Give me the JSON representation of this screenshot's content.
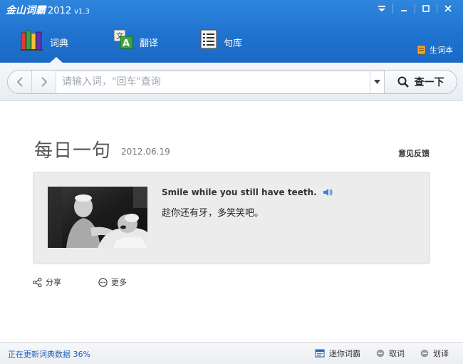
{
  "window": {
    "brand": "金山词霸",
    "year": "2012",
    "version": "v1.3"
  },
  "tabs": [
    {
      "label": "词典",
      "icon": "books-icon",
      "active": true
    },
    {
      "label": "翻译",
      "icon": "translate-icon",
      "active": false
    },
    {
      "label": "句库",
      "icon": "document-list-icon",
      "active": false
    }
  ],
  "vocab_label": "生词本",
  "search": {
    "placeholder": "请输入词，\"回车\"查询",
    "button_label": "查一下"
  },
  "daily": {
    "title": "每日一句",
    "date": "2012.06.19",
    "feedback": "意见反馈",
    "sentence_en": "Smile while you still have teeth.",
    "sentence_cn": "趁你还有牙，多笑笑吧。",
    "share_label": "分享",
    "more_label": "更多"
  },
  "status": {
    "text": "正在更新词典数据 36%",
    "mini_label": "迷你词霸",
    "lookup_label": "取词",
    "select_label": "划译"
  },
  "colors": {
    "titlebar": "#1f73cf",
    "status_text": "#1f5fb8"
  }
}
